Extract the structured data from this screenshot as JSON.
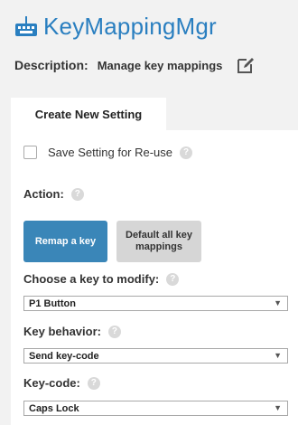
{
  "app": {
    "title": "KeyMappingMgr",
    "icon": "keyboard-icon",
    "accent": "#2a7fc0"
  },
  "description": {
    "label": "Description:",
    "value": "Manage key mappings",
    "edit_icon": "edit-icon"
  },
  "tabs": [
    {
      "label": "Create New Setting",
      "active": true
    }
  ],
  "form": {
    "save_setting": {
      "label": "Save Setting for Re-use",
      "checked": false
    },
    "action": {
      "label": "Action:"
    },
    "buttons": {
      "remap": "Remap a key",
      "default_all": "Default all key mappings"
    },
    "choose_key": {
      "label": "Choose a key to modify:",
      "value": "P1 Button"
    },
    "key_behavior": {
      "label": "Key behavior:",
      "value": "Send key-code"
    },
    "key_code": {
      "label": "Key-code:",
      "value": "Caps Lock"
    },
    "help_symbol": "?"
  },
  "colors": {
    "primary_button": "#3a86b8",
    "secondary_button": "#d6d6d6",
    "background": "#f2f2f2"
  }
}
